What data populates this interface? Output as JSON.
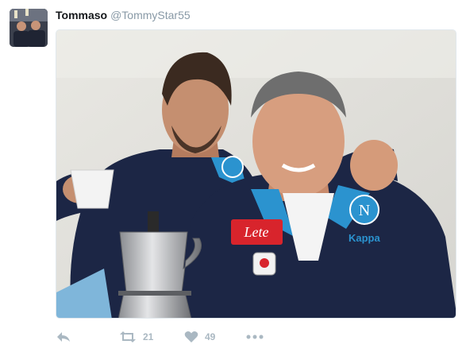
{
  "tweet": {
    "author_name": "Tommaso",
    "author_handle": "@TommyStar55",
    "retweet_count": "21",
    "like_count": "49"
  },
  "photo": {
    "jacket_brand": "Kappa",
    "sponsor": "Lete",
    "crest_letter": "N"
  },
  "colors": {
    "jacket_navy": "#1c2645",
    "collar_blue": "#2b93cf",
    "icon_gray": "#aab8c2",
    "handle_gray": "#8899a6"
  },
  "icons": [
    "reply-icon",
    "retweet-icon",
    "heart-icon",
    "more-icon"
  ]
}
